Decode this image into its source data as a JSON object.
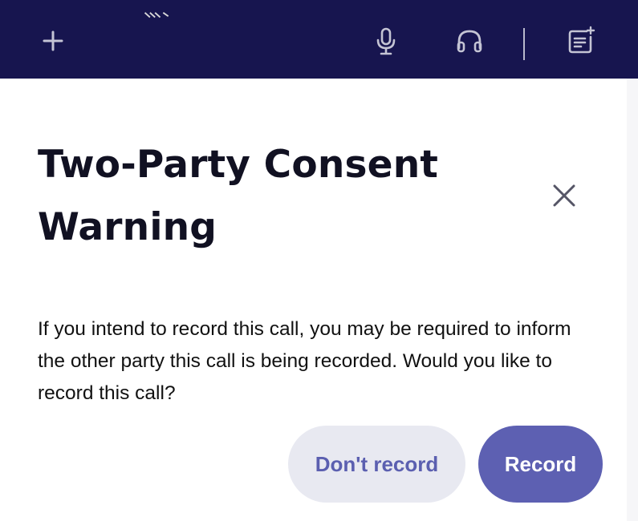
{
  "toolbar": {
    "icons": [
      "plus-icon",
      "microphone-icon",
      "headphones-icon",
      "notes-icon"
    ],
    "background": "#17154f"
  },
  "dialog": {
    "title": "Two-Party Consent Warning",
    "message": "If you intend to record this call, you may be required to inform the other party this call is being recorded. Would you like to record this call?",
    "close_icon": "close-icon",
    "buttons": {
      "secondary_label": "Don't record",
      "primary_label": "Record"
    }
  },
  "colors": {
    "primary": "#5d60b2",
    "secondary_bg": "#e8e9f1",
    "title_text": "#111122"
  }
}
